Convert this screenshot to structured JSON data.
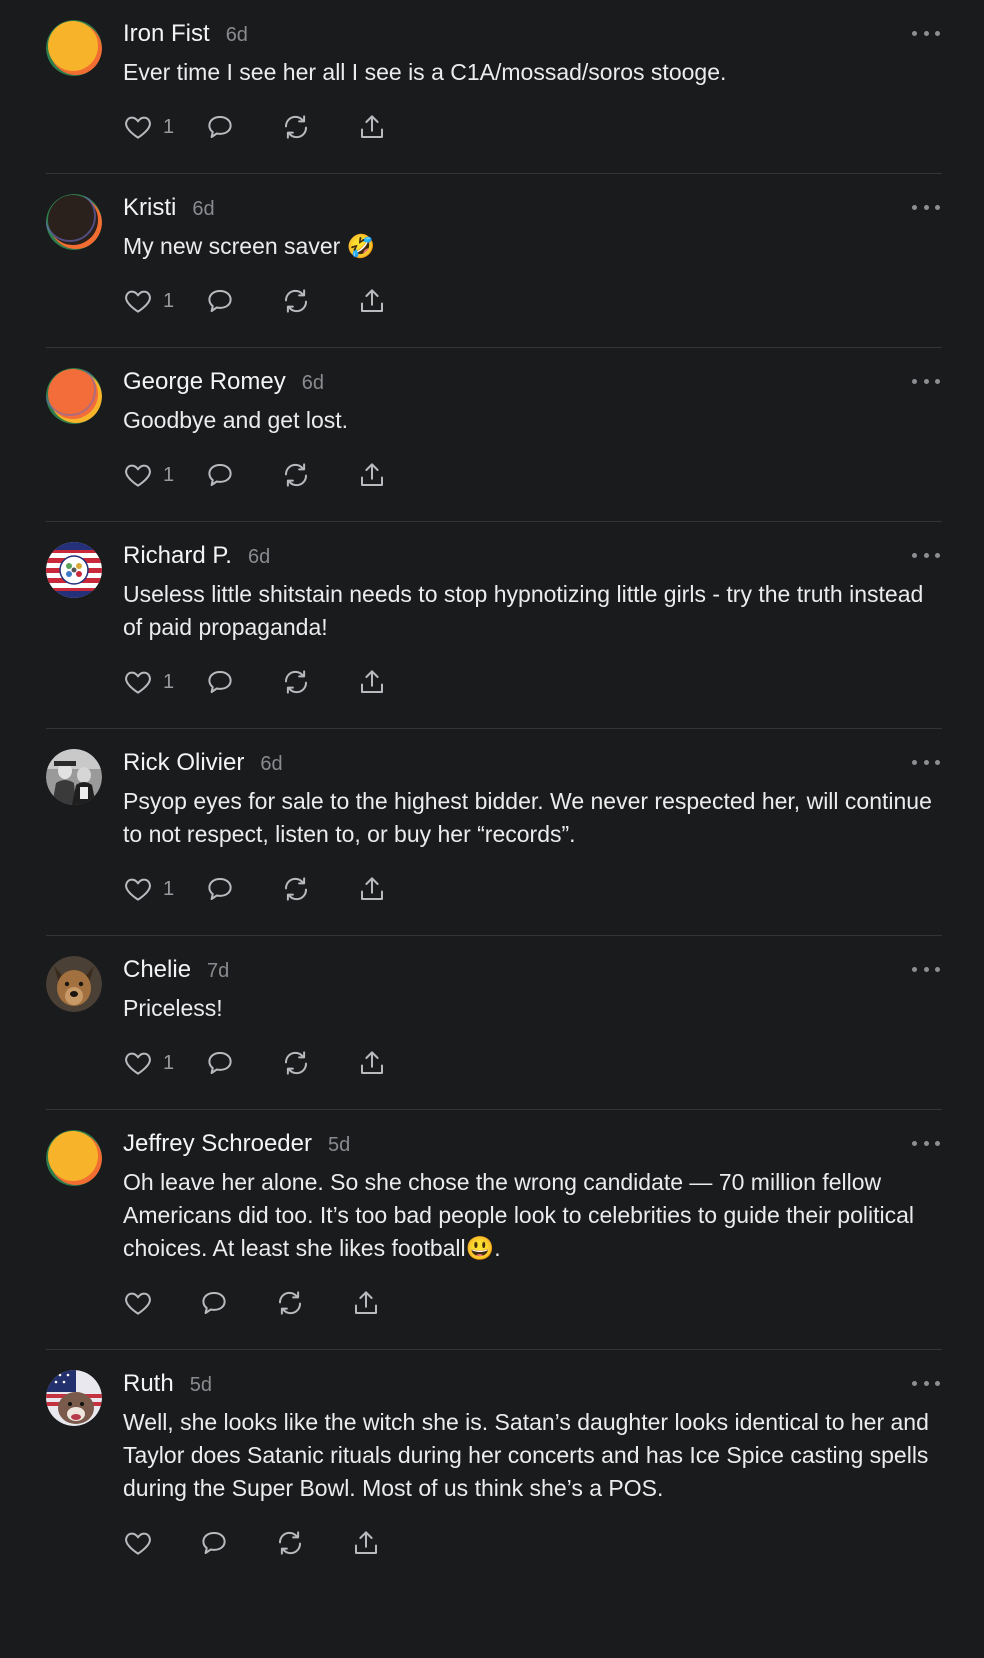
{
  "comments": [
    {
      "name": "Iron Fist",
      "time": "6d",
      "text": "Ever time I see her all I see is a C1A/mossad/soros stooge.",
      "likes": "1",
      "avatar": "orange"
    },
    {
      "name": "Kristi",
      "time": "6d",
      "text": "My new screen saver 🤣",
      "likes": "1",
      "avatar": "dark"
    },
    {
      "name": "George Romey",
      "time": "6d",
      "text": "Goodbye and get lost.",
      "likes": "1",
      "avatar": "red-orange"
    },
    {
      "name": "Richard P.",
      "time": "6d",
      "text": "Useless little shitstain needs to stop hypnotizing little girls - try the truth instead of paid propaganda!",
      "likes": "1",
      "avatar": "flag-badge"
    },
    {
      "name": "Rick Olivier",
      "time": "6d",
      "text": "Psyop eyes for sale to the highest bidder. We never respected her, will continue to not respect, listen to, or buy her “records”.",
      "likes": "1",
      "avatar": "bw-photo"
    },
    {
      "name": "Chelie",
      "time": "7d",
      "text": "Priceless!",
      "likes": "1",
      "avatar": "dog-photo"
    },
    {
      "name": "Jeffrey Schroeder",
      "time": "5d",
      "text": "Oh leave her alone. So she chose the wrong candidate — 70 million fellow Americans did too. It’s too bad people look to celebrities to guide their political choices. At least she likes football😃.",
      "likes": "",
      "avatar": "orange"
    },
    {
      "name": "Ruth",
      "time": "5d",
      "text": "Well, she looks like the witch she is. Satan’s daughter looks identical to her and Taylor does Satanic rituals during her concerts and has Ice Spice casting spells during the Super Bowl. Most of us think she’s a POS.",
      "likes": "",
      "avatar": "flag-dog"
    }
  ],
  "colors": {
    "background": "#1a1b1d",
    "divider": "#34353a",
    "icon": "#b9babe",
    "muted": "#8a8b8f"
  },
  "icons": {
    "like": "heart-icon",
    "reply": "comment-bubble-icon",
    "restack": "restack-icon",
    "share": "share-icon",
    "more": "more-dots-icon"
  }
}
